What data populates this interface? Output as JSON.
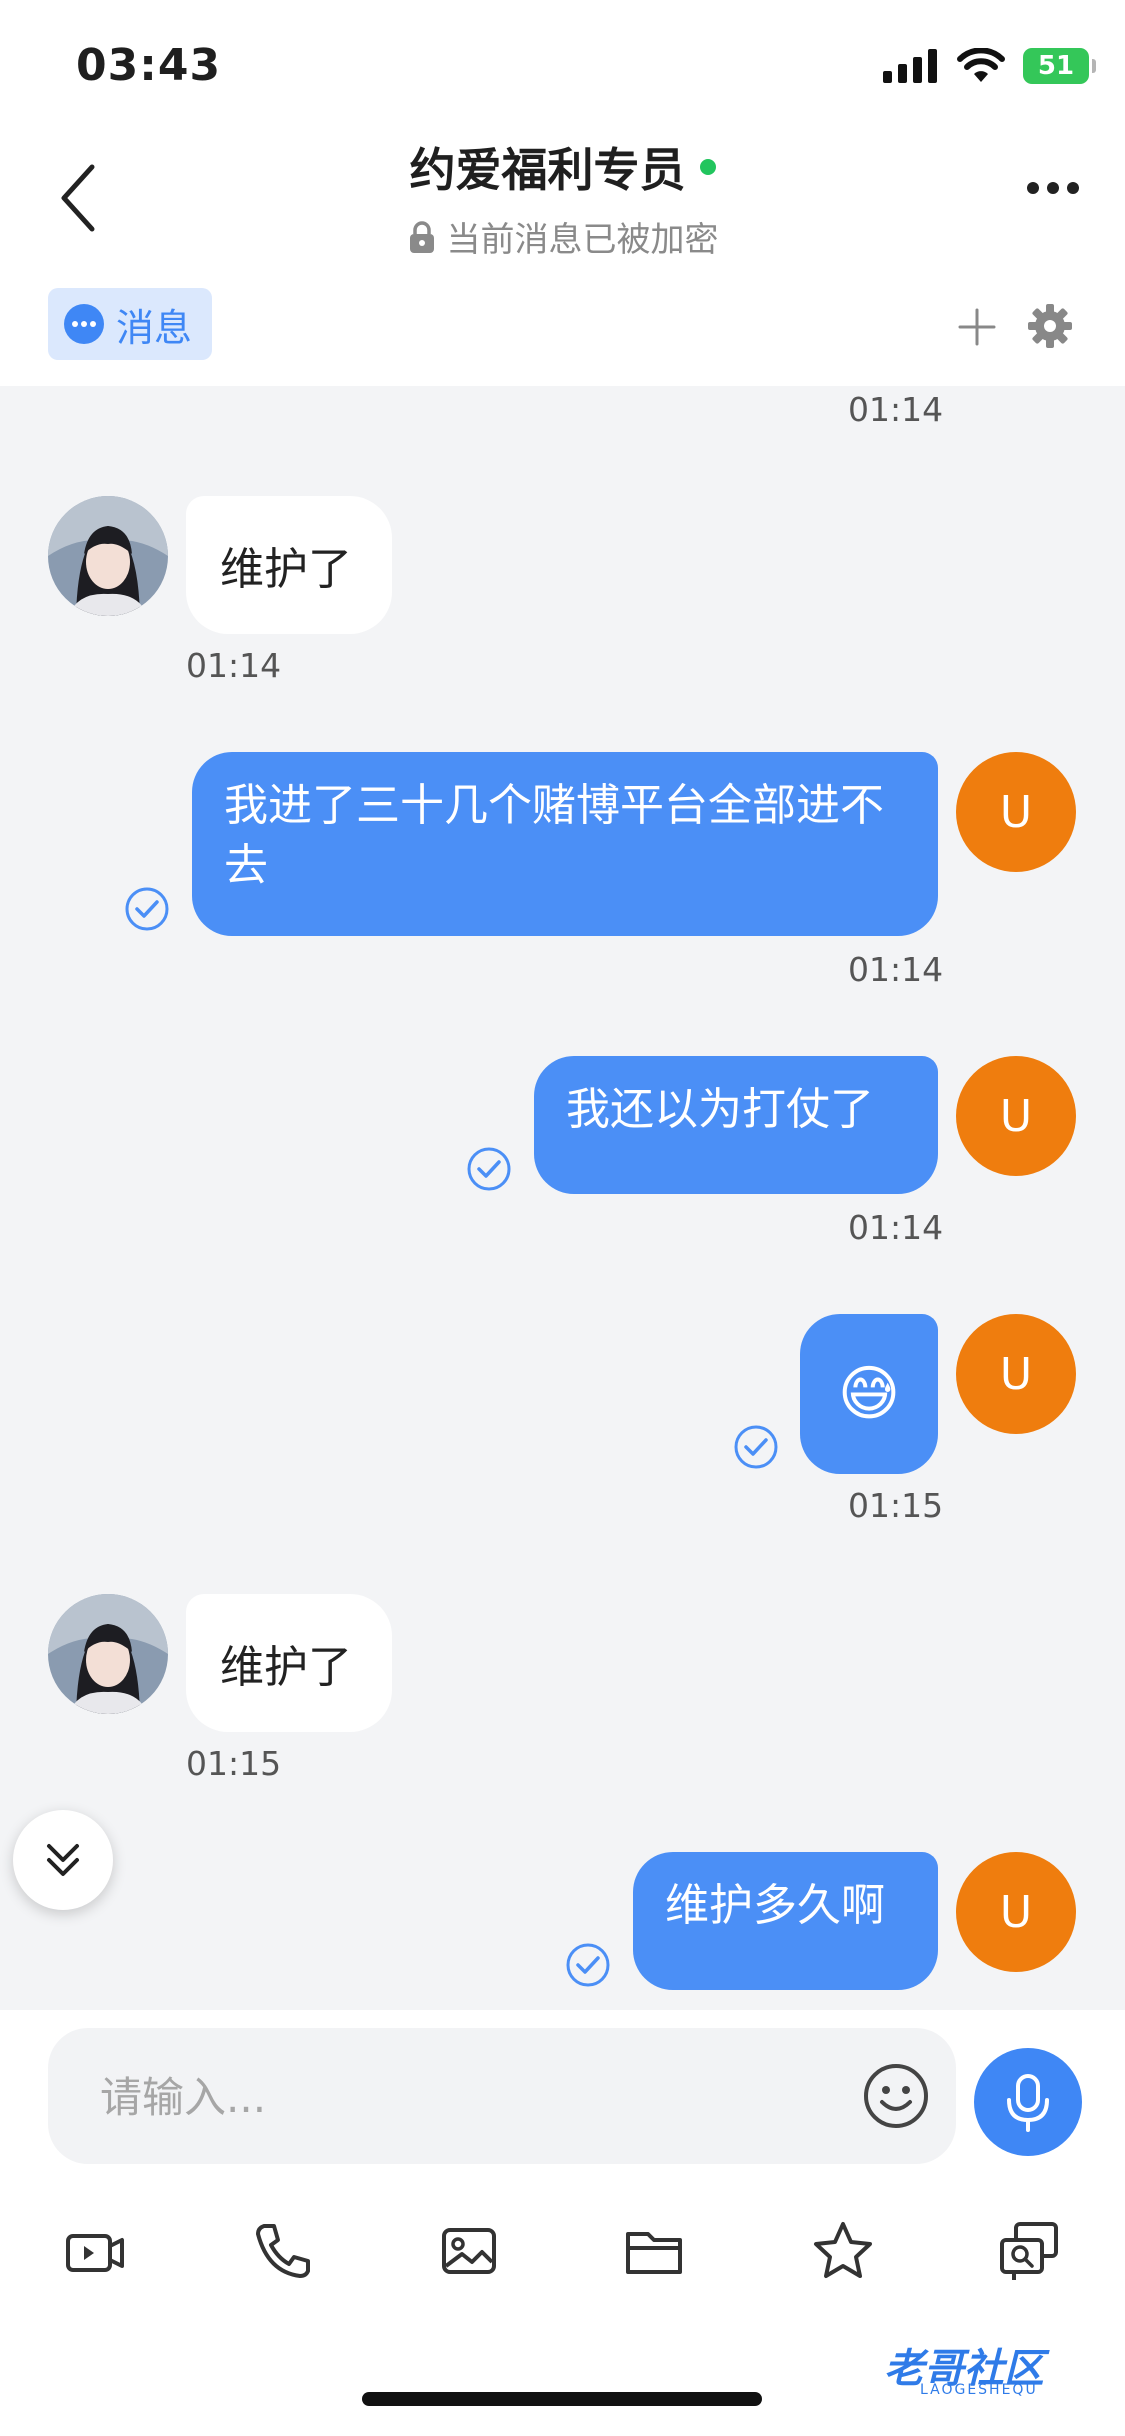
{
  "status": {
    "time": "03:43",
    "battery": "51"
  },
  "header": {
    "title": "约爱福利专员",
    "subtitle": "当前消息已被加密"
  },
  "tabs": {
    "messages_label": "消息"
  },
  "chat": {
    "messages": [
      {
        "from": "other",
        "text": "",
        "time": "01:14"
      },
      {
        "from": "other",
        "text": "维护了",
        "time": "01:14"
      },
      {
        "from": "me",
        "text": "我进了三十几个赌博平台全部进不去",
        "time": "01:14",
        "avatar": "U"
      },
      {
        "from": "me",
        "text": "我还以为打仗了",
        "time": "01:14",
        "avatar": "U"
      },
      {
        "from": "me",
        "text": "😅",
        "time": "01:15",
        "avatar": "U"
      },
      {
        "from": "other",
        "text": "维护了",
        "time": "01:15"
      },
      {
        "from": "me",
        "text": "维护多久啊",
        "time": "",
        "avatar": "U"
      }
    ]
  },
  "input": {
    "placeholder": "请输入..."
  },
  "watermark": {
    "text": "老哥社区",
    "sub": "LAOGESHEQU"
  },
  "colors": {
    "accent": "#3f87f5",
    "my_bubble": "#4b8ff6",
    "my_avatar": "#ef7d0e",
    "online": "#22c55e"
  },
  "icons": [
    "back-arrow-icon",
    "more-icon",
    "lock-icon",
    "chat-bubble-icon",
    "plus-icon",
    "gear-icon",
    "read-check-icon",
    "double-chevron-down-icon",
    "emoji-icon",
    "microphone-icon",
    "video-icon",
    "phone-icon",
    "image-icon",
    "folder-icon",
    "star-icon",
    "screen-share-icon"
  ]
}
